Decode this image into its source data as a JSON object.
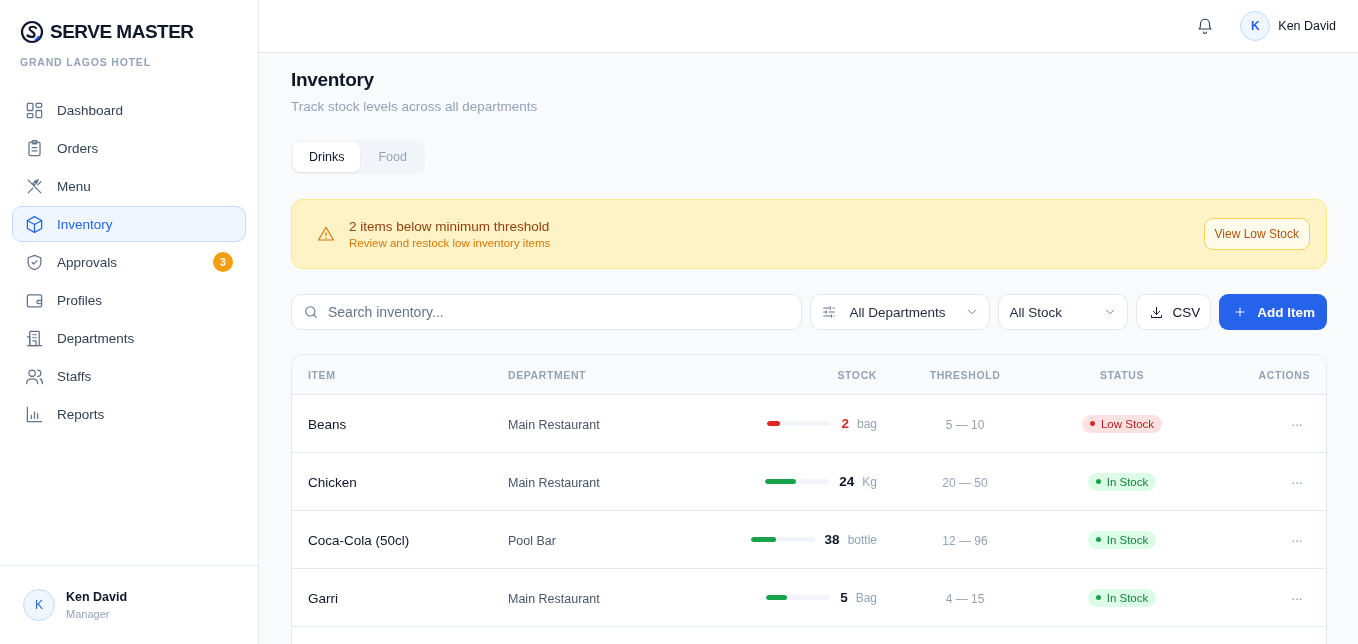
{
  "brand": {
    "name": "SERVE MASTER",
    "subtitle": "GRAND LAGOS HOTEL"
  },
  "sidebar": {
    "items": [
      {
        "label": "Dashboard",
        "selected": false
      },
      {
        "label": "Orders",
        "selected": false
      },
      {
        "label": "Menu",
        "selected": false
      },
      {
        "label": "Inventory",
        "selected": true
      },
      {
        "label": "Approvals",
        "selected": false,
        "badge": "3"
      },
      {
        "label": "Profiles",
        "selected": false
      },
      {
        "label": "Departments",
        "selected": false
      },
      {
        "label": "Staffs",
        "selected": false
      },
      {
        "label": "Reports",
        "selected": false
      }
    ],
    "user": {
      "initial": "K",
      "name": "Ken David",
      "role": "Manager"
    }
  },
  "topbar": {
    "user": {
      "initial": "K",
      "name": "Ken David"
    }
  },
  "page": {
    "title": "Inventory",
    "subtitle": "Track stock levels across all departments"
  },
  "tabs": [
    {
      "label": "Drinks",
      "selected": true
    },
    {
      "label": "Food",
      "selected": false
    }
  ],
  "alert": {
    "title": "2 items below minimum threshold",
    "message": "Review and restock low inventory items",
    "button": "View Low Stock"
  },
  "toolbar": {
    "search": {
      "placeholder": "Search inventory..."
    },
    "department_filter": "All Departments",
    "stock_filter": "All Stock",
    "export_button": "CSV",
    "add_button": "Add Item"
  },
  "table": {
    "columns": [
      "ITEM",
      "DEPARTMENT",
      "STOCK",
      "THRESHOLD",
      "STATUS",
      "ACTIONS"
    ],
    "rows": [
      {
        "item": "Beans",
        "department": "Main Restaurant",
        "level": 0.2,
        "stock": "2",
        "unit": "bag",
        "threshold": "5 — 10",
        "status": "Low Stock",
        "kind": "low",
        "actions": "···"
      },
      {
        "item": "Chicken",
        "department": "Main Restaurant",
        "level": 0.48,
        "stock": "24",
        "unit": "Kg",
        "threshold": "20 — 50",
        "status": "In Stock",
        "kind": "ok",
        "actions": "···"
      },
      {
        "item": "Coca-Cola (50cl)",
        "department": "Pool Bar",
        "level": 0.4,
        "stock": "38",
        "unit": "bottle",
        "threshold": "12 — 96",
        "status": "In Stock",
        "kind": "ok",
        "actions": "···"
      },
      {
        "item": "Garri",
        "department": "Main Restaurant",
        "level": 0.33,
        "stock": "5",
        "unit": "Bag",
        "threshold": "4 — 15",
        "status": "In Stock",
        "kind": "ok",
        "actions": "···"
      }
    ]
  }
}
